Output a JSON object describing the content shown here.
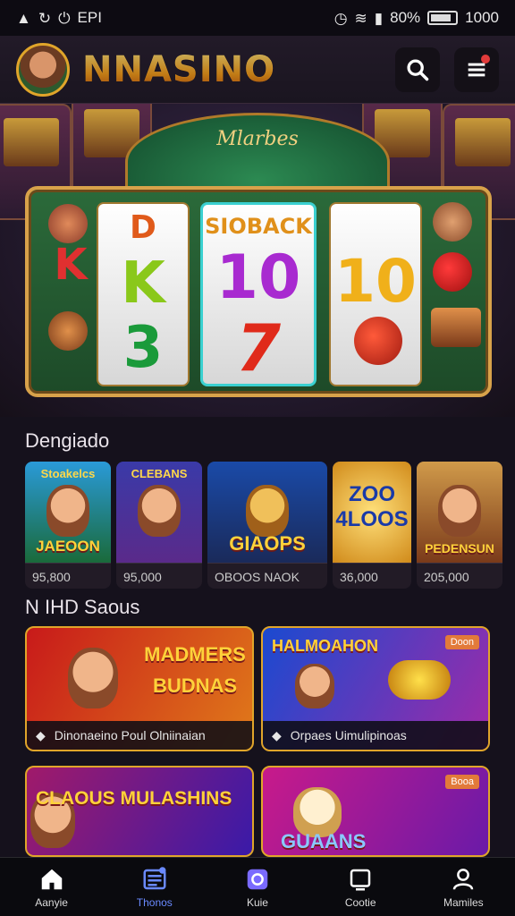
{
  "status_bar": {
    "left_label": "EPI",
    "right_label": "80%",
    "time": "1000"
  },
  "header": {
    "brand": "NNASINO",
    "icons": [
      "search-icon",
      "menu-icon"
    ],
    "notification_color": "#e23b3b"
  },
  "hero": {
    "table_title": "Mlarbes",
    "reels": [
      {
        "top": "D",
        "mid": "K",
        "bot": "3"
      },
      {
        "top": "SIOBACK",
        "mid": "10",
        "bot": "7"
      },
      {
        "top": "",
        "mid": "10",
        "bot": ""
      }
    ]
  },
  "section1": {
    "title": "Dengiado",
    "games": [
      {
        "top": "Stoakelcs",
        "name": "JAEOON",
        "price": "95,800"
      },
      {
        "top": "CLEBANS",
        "name": "",
        "price": "95,000"
      },
      {
        "top": "",
        "name": "GIAOPS",
        "price": "OBOOS NAOK"
      },
      {
        "top": "",
        "name": "ZOO 4LOOS",
        "price": "36,000"
      },
      {
        "top": "",
        "name": "PEDENSUN",
        "price": "205,000"
      }
    ]
  },
  "section2": {
    "title": "N IHD Saous",
    "promos": [
      {
        "title": "MADMERS BUDNAS",
        "footer": "Dinonaeino Poul Olniinaian",
        "tag": ""
      },
      {
        "title": "HALMOAHON",
        "footer": "Orpaes Uimulipinoas",
        "tag": "Doon"
      },
      {
        "title": "CLAOUS MULASHINS",
        "footer": "",
        "tag": ""
      },
      {
        "title": "GUAANS",
        "footer": "",
        "tag": "Booa"
      }
    ]
  },
  "bottom_nav": {
    "items": [
      {
        "label": "Aanyie",
        "icon": "home-icon",
        "active": false
      },
      {
        "label": "Thonos",
        "icon": "list-icon",
        "active": true
      },
      {
        "label": "Kuie",
        "icon": "camera-icon",
        "active": false
      },
      {
        "label": "Cootie",
        "icon": "square-icon",
        "active": false
      },
      {
        "label": "Mamiles",
        "icon": "profile-icon",
        "active": false
      }
    ],
    "active_color": "#6a8aff"
  }
}
